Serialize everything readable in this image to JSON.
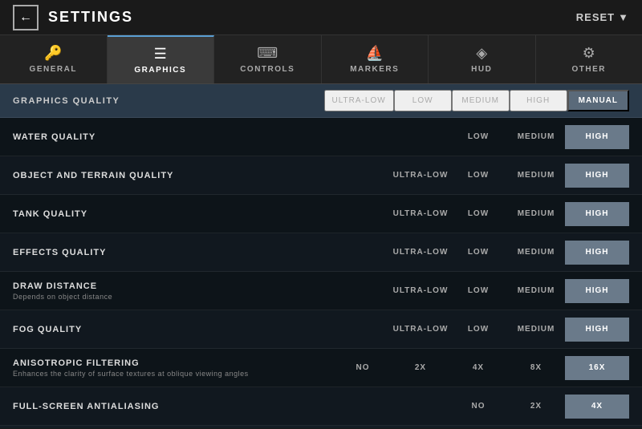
{
  "titleBar": {
    "back_label": "←",
    "title": "SETTINGS",
    "reset_label": "RESET",
    "reset_arrow": "▼"
  },
  "tabs": [
    {
      "id": "general",
      "label": "GENERAL",
      "icon": "🔑",
      "active": false
    },
    {
      "id": "graphics",
      "label": "GRAPHICS",
      "icon": "☰",
      "active": true
    },
    {
      "id": "controls",
      "label": "CONTROLS",
      "icon": "⌨",
      "active": false
    },
    {
      "id": "markers",
      "label": "MARKERS",
      "icon": "⛵",
      "active": false
    },
    {
      "id": "hud",
      "label": "HUD",
      "icon": "◈",
      "active": false
    },
    {
      "id": "other",
      "label": "OTHER",
      "icon": "⚙",
      "active": false
    }
  ],
  "graphicsQuality": {
    "label": "GRAPHICS QUALITY",
    "options": [
      "ULTRA-LOW",
      "LOW",
      "MEDIUM",
      "HIGH",
      "MANUAL"
    ],
    "selected": "MANUAL"
  },
  "settings": [
    {
      "name": "WATER QUALITY",
      "desc": "",
      "options": [
        "LOW",
        "MEDIUM",
        "HIGH"
      ],
      "values": [
        "LOW",
        "MEDIUM",
        "HIGH"
      ],
      "selected": "HIGH"
    },
    {
      "name": "OBJECT AND TERRAIN QUALITY",
      "desc": "",
      "options": [
        "ULTRA-LOW",
        "LOW",
        "MEDIUM",
        "HIGH"
      ],
      "values": [
        "ULTRA-LOW",
        "LOW",
        "MEDIUM",
        "HIGH"
      ],
      "selected": "HIGH"
    },
    {
      "name": "TANK QUALITY",
      "desc": "",
      "options": [
        "ULTRA-LOW",
        "LOW",
        "MEDIUM",
        "HIGH"
      ],
      "values": [
        "ULTRA-LOW",
        "LOW",
        "MEDIUM",
        "HIGH"
      ],
      "selected": "HIGH"
    },
    {
      "name": "EFFECTS QUALITY",
      "desc": "",
      "options": [
        "ULTRA-LOW",
        "LOW",
        "MEDIUM",
        "HIGH"
      ],
      "values": [
        "ULTRA-LOW",
        "LOW",
        "MEDIUM",
        "HIGH"
      ],
      "selected": "HIGH"
    },
    {
      "name": "DRAW DISTANCE",
      "desc": "Depends on object distance",
      "options": [
        "ULTRA-LOW",
        "LOW",
        "MEDIUM",
        "HIGH"
      ],
      "values": [
        "ULTRA-LOW",
        "LOW",
        "MEDIUM",
        "HIGH"
      ],
      "selected": "HIGH"
    },
    {
      "name": "FOG QUALITY",
      "desc": "",
      "options": [
        "ULTRA-LOW",
        "LOW",
        "MEDIUM",
        "HIGH"
      ],
      "values": [
        "ULTRA-LOW",
        "LOW",
        "MEDIUM",
        "HIGH"
      ],
      "selected": "HIGH"
    },
    {
      "name": "ANISOTROPIC FILTERING",
      "desc": "Enhances the clarity of surface textures at oblique viewing angles",
      "options": [
        "NO",
        "2X",
        "4X",
        "8X",
        "16X"
      ],
      "values": [
        "NO",
        "2X",
        "4X",
        "8X",
        "16X"
      ],
      "selected": "16X"
    },
    {
      "name": "FULL-SCREEN ANTIALIASING",
      "desc": "",
      "options": [
        "NO",
        "2X",
        "4X"
      ],
      "values": [
        "NO",
        "2X",
        "4X"
      ],
      "selected": "4X"
    }
  ]
}
